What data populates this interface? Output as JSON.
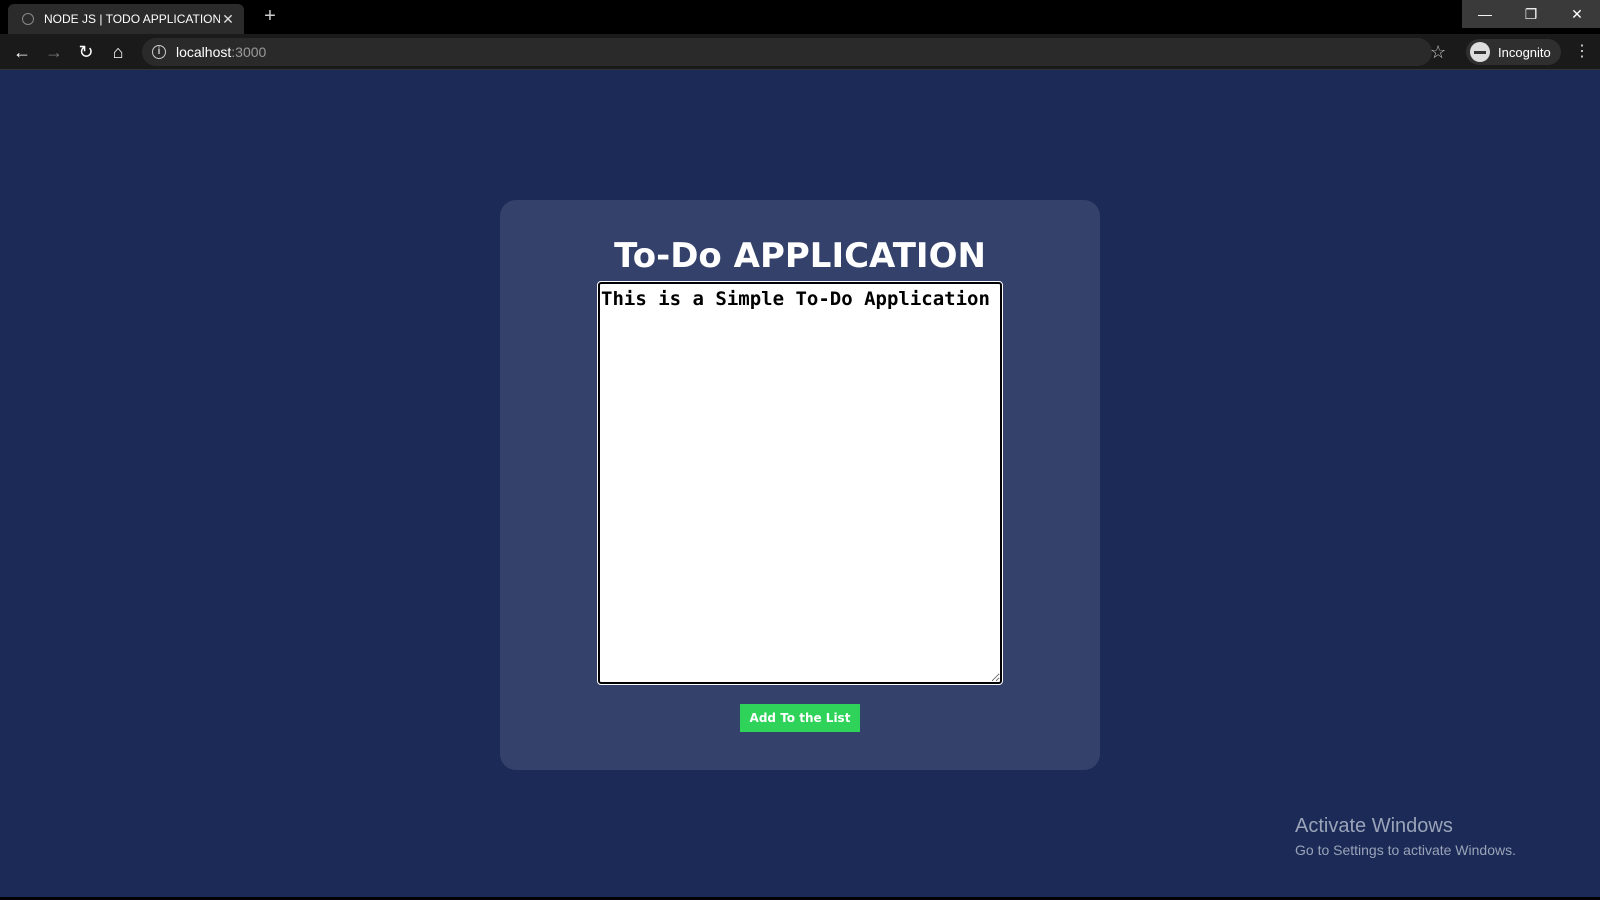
{
  "browser": {
    "tab_title": "NODE JS | TODO APPLICATION",
    "tab_close": "✕",
    "new_tab": "+",
    "url_host": "localhost",
    "url_port": ":3000",
    "profile_label": "Incognito",
    "icons": [
      "back-arrow-icon",
      "forward-arrow-icon",
      "reload-icon",
      "home-icon",
      "info-icon",
      "star-icon",
      "incognito-icon",
      "menu-icon"
    ]
  },
  "window_controls": {
    "minimize": "—",
    "maximize": "❐",
    "close": "✕"
  },
  "app": {
    "title": "To-Do APPLICATION",
    "textarea_value": "This is a Simple To-Do Application",
    "add_button_label": "Add To the List",
    "colors": {
      "page_bg": "#1b2a56",
      "card_bg": "#34416a",
      "button_bg": "#2fd35a"
    }
  },
  "watermark": {
    "line1": "Activate Windows",
    "line2": "Go to Settings to activate Windows."
  }
}
